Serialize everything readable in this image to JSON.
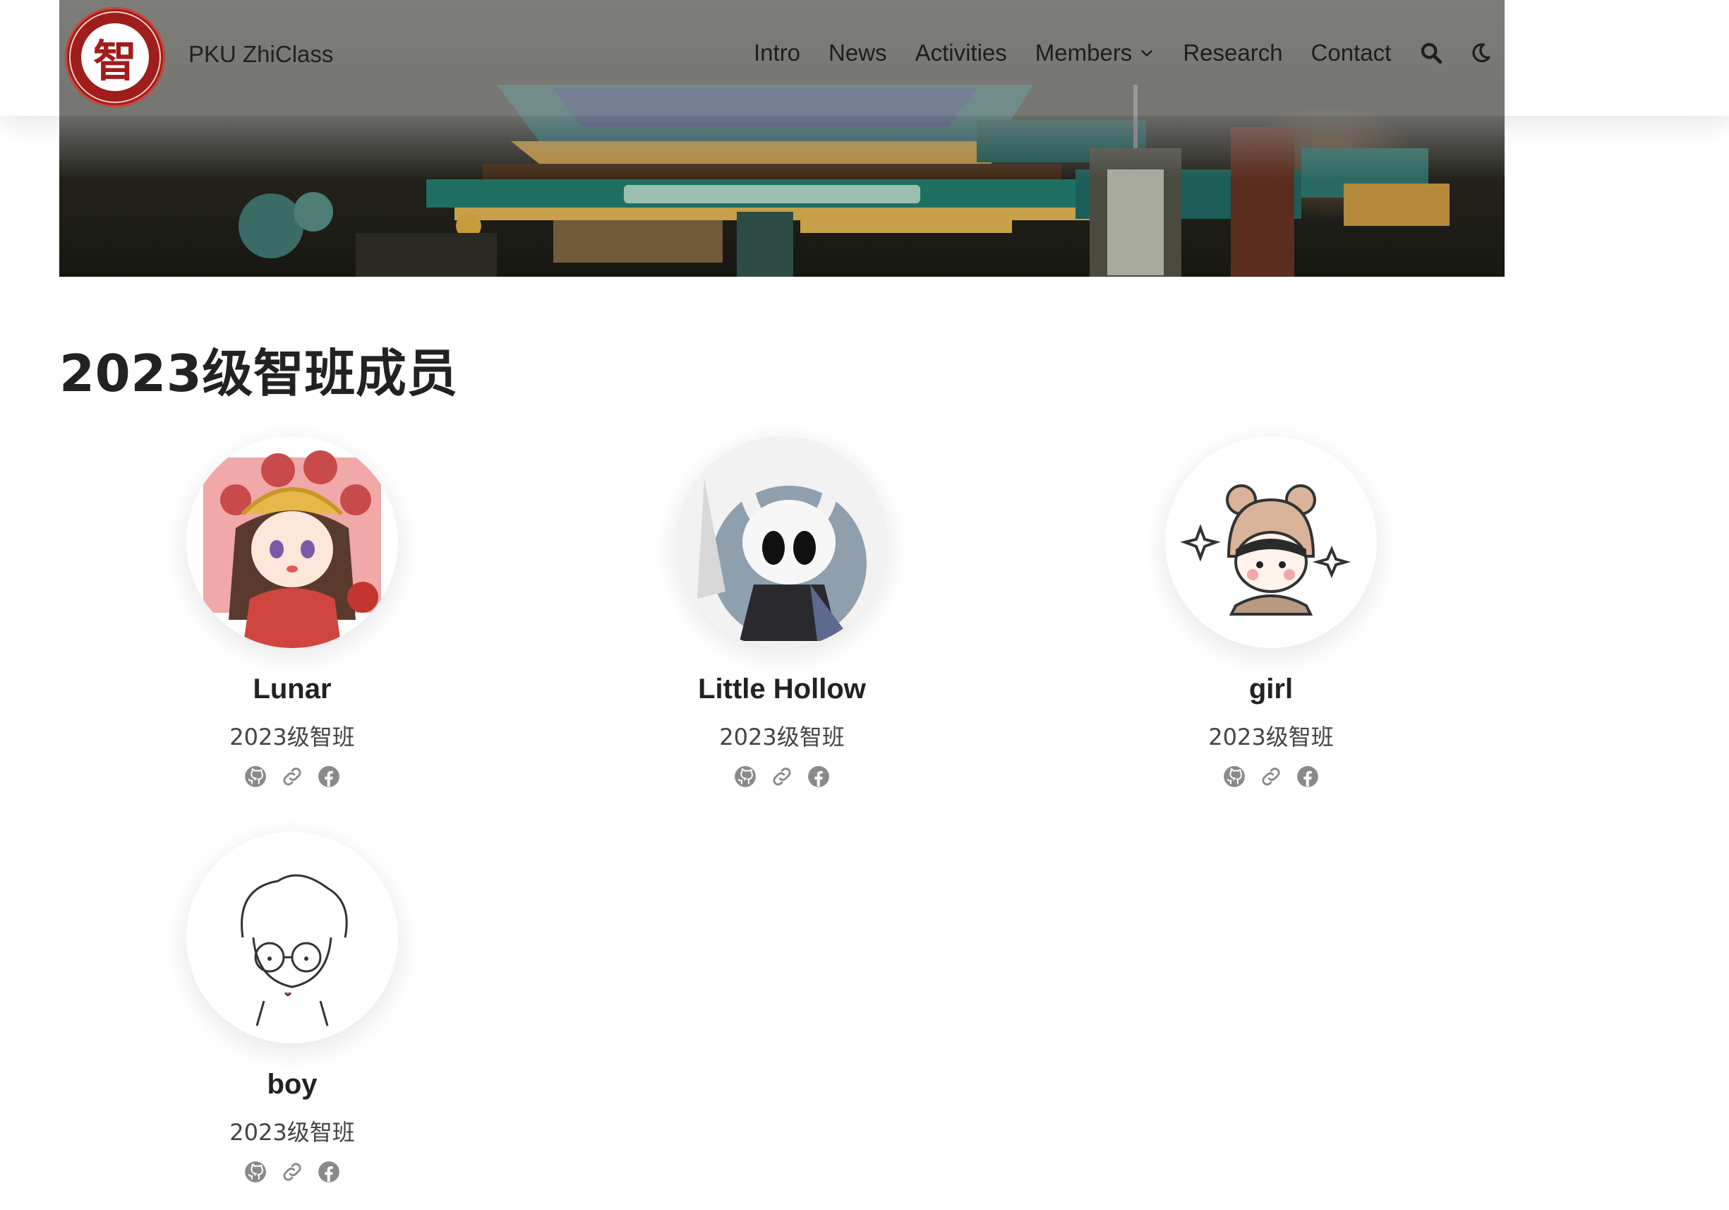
{
  "site": {
    "brand": "PKU ZhiClass",
    "logo_char": "智",
    "logo_ring_text": "ASSEMBLY OF INTELLECT 2022"
  },
  "nav": {
    "items": [
      "Intro",
      "News",
      "Activities",
      "Members",
      "Research",
      "Contact"
    ],
    "search_icon": "search-icon",
    "theme_icon": "moon-icon"
  },
  "page": {
    "title": "2023级智班成员"
  },
  "members": [
    {
      "name": "Lunar",
      "role": "2023级智班",
      "avatar": "chibi-girl-red-robe"
    },
    {
      "name": "Little Hollow",
      "role": "2023级智班",
      "avatar": "hollow-knight"
    },
    {
      "name": "girl",
      "role": "2023级智班",
      "avatar": "girl-bear-hat"
    },
    {
      "name": "boy",
      "role": "2023级智班",
      "avatar": "boy-glasses-sketch"
    }
  ],
  "social_icons": [
    "github-icon",
    "link-icon",
    "facebook-icon"
  ],
  "colors": {
    "logo_red": "#9f1d1b",
    "text": "#222222",
    "subtext": "#444444",
    "icon_gray": "#8a8a8a"
  }
}
